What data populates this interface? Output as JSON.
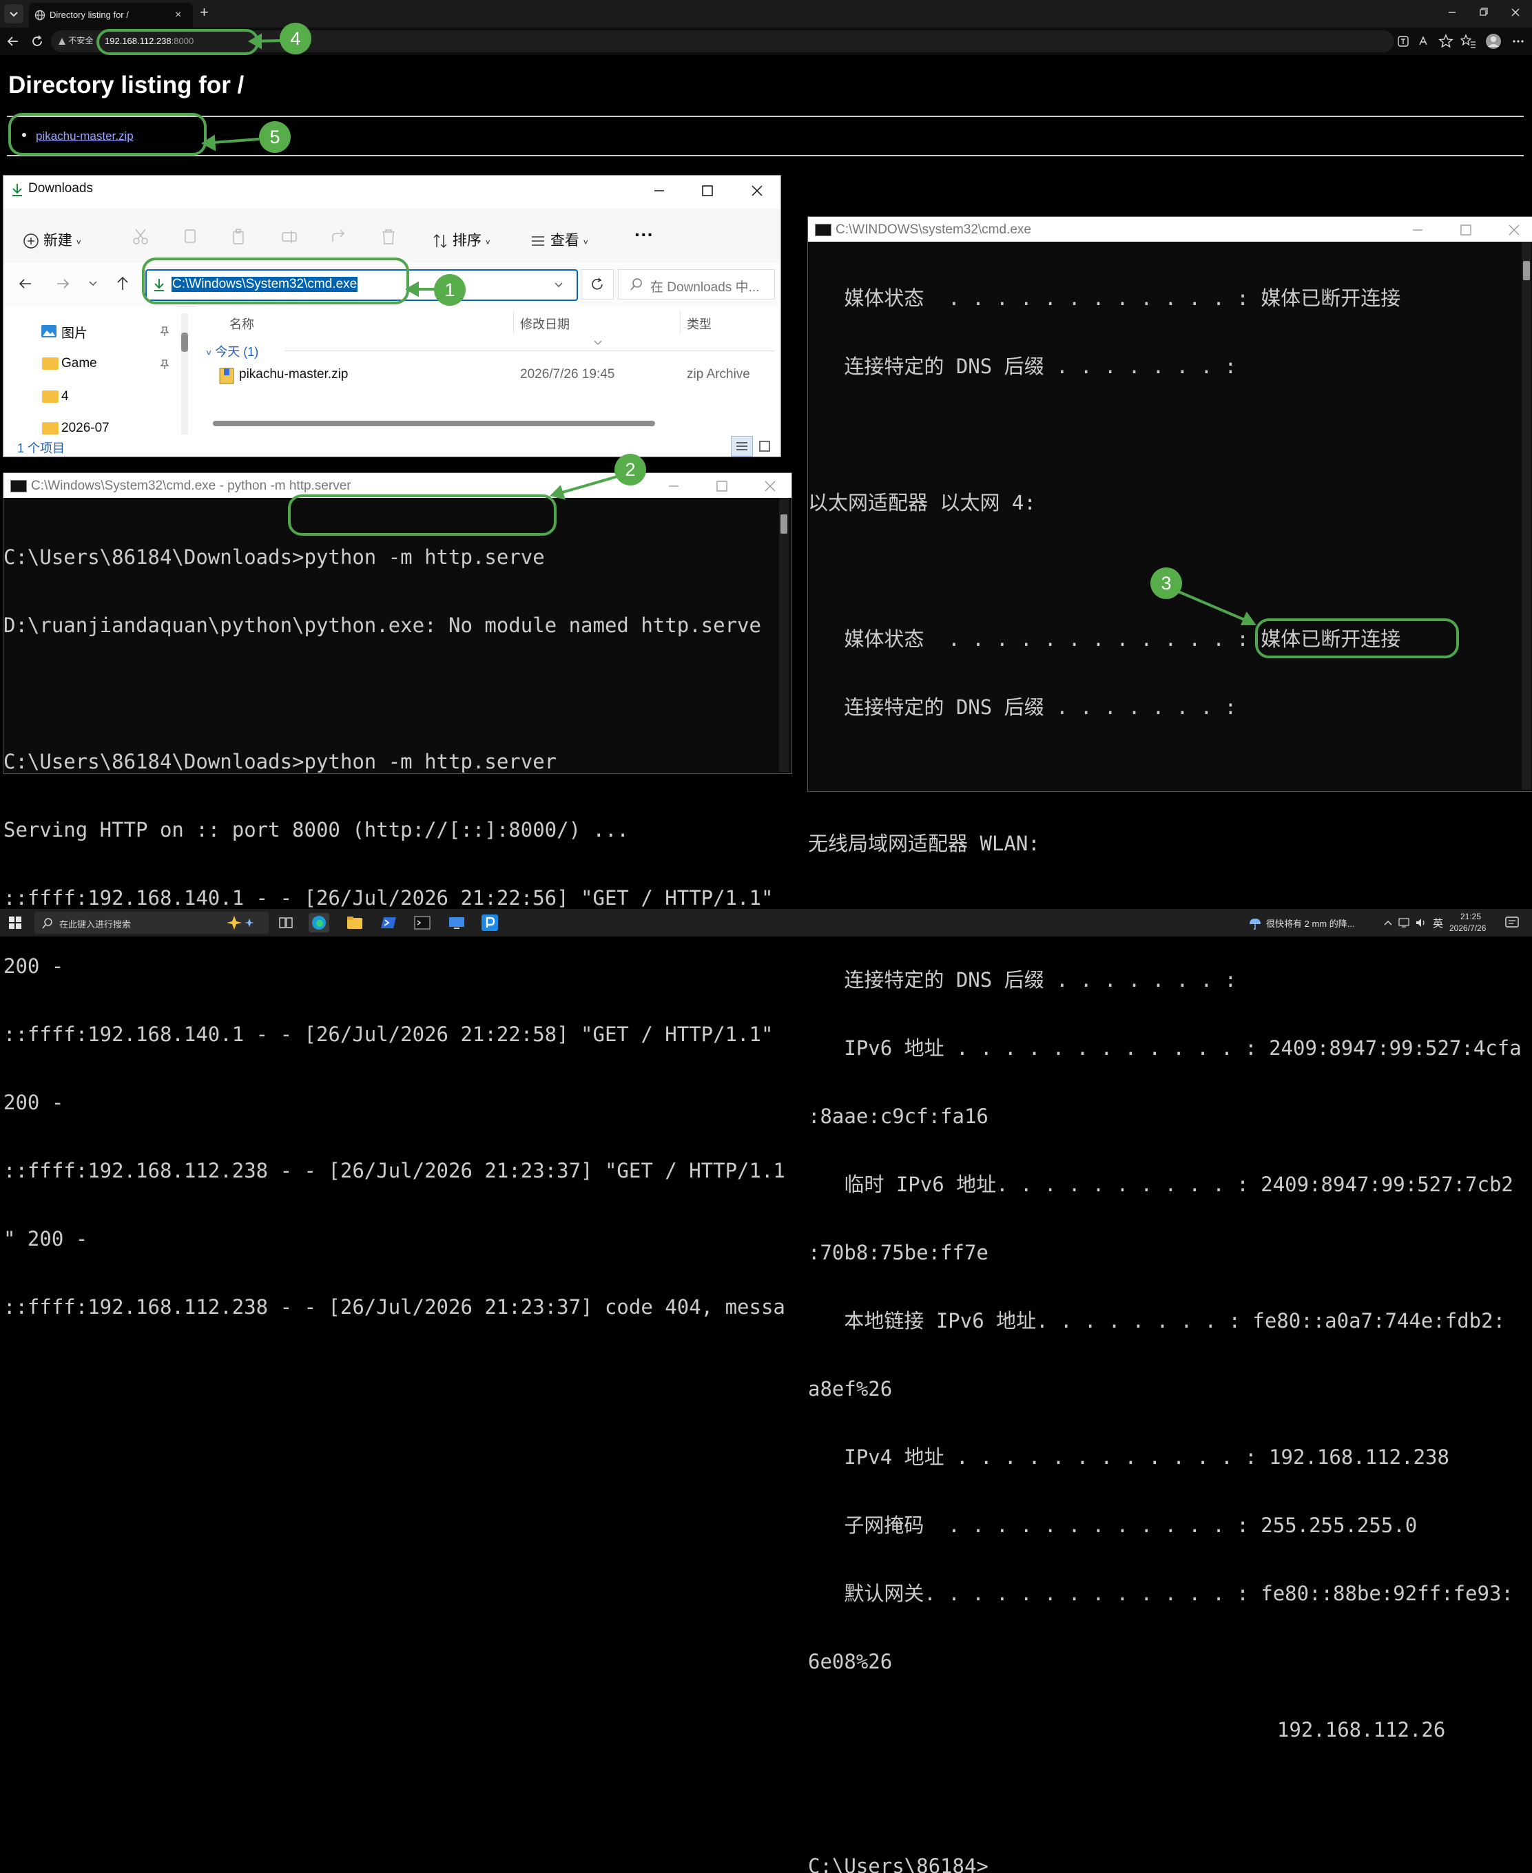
{
  "browser": {
    "tab_title": "Directory listing for /",
    "tab_close": "×",
    "new_tab": "+",
    "address_security": "不安全",
    "address_host": "192.168.112.238",
    "address_port": ":8000",
    "page_title": "Directory listing for /",
    "links": [
      "pikachu-master.zip"
    ]
  },
  "explorer": {
    "title": "Downloads",
    "toolbar": {
      "new_label": "新建",
      "sort_label": "排序",
      "view_label": "查看",
      "more_label": "···"
    },
    "address_value": "C:\\Windows\\System32\\cmd.exe",
    "search_placeholder": "在 Downloads 中...",
    "sidebar": [
      "图片",
      "Game",
      "4",
      "2026-07"
    ],
    "columns": {
      "name": "名称",
      "date": "修改日期",
      "type": "类型"
    },
    "group_label": "今天 (1)",
    "files": [
      {
        "name": "pikachu-master.zip",
        "date": "2026/7/26 19:45",
        "type": "zip Archive"
      }
    ],
    "status": "1 个项目"
  },
  "cmd_server": {
    "title": "C:\\Windows\\System32\\cmd.exe - python  -m http.server",
    "lines": [
      "C:\\Users\\86184\\Downloads>python -m http.serve",
      "D:\\ruanjiandaquan\\python\\python.exe: No module named http.serve",
      "",
      "C:\\Users\\86184\\Downloads>python -m http.server",
      "Serving HTTP on :: port 8000 (http://[::]:8000/) ...",
      "::ffff:192.168.140.1 - - [26/Jul/2026 21:22:56] \"GET / HTTP/1.1\"",
      "200 -",
      "::ffff:192.168.140.1 - - [26/Jul/2026 21:22:58] \"GET / HTTP/1.1\"",
      "200 -",
      "::ffff:192.168.112.238 - - [26/Jul/2026 21:23:37] \"GET / HTTP/1.1",
      "\" 200 -",
      "::ffff:192.168.112.238 - - [26/Jul/2026 21:23:37] code 404, messa"
    ]
  },
  "cmd_ipconfig": {
    "title": "C:\\WINDOWS\\system32\\cmd.exe",
    "lines": [
      "   媒体状态  . . . . . . . . . . . . : 媒体已断开连接",
      "   连接特定的 DNS 后缀 . . . . . . . :",
      "",
      "以太网适配器 以太网 4:",
      "",
      "   媒体状态  . . . . . . . . . . . . : 媒体已断开连接",
      "   连接特定的 DNS 后缀 . . . . . . . :",
      "",
      "无线局域网适配器 WLAN:",
      "",
      "   连接特定的 DNS 后缀 . . . . . . . :",
      "   IPv6 地址 . . . . . . . . . . . . : 2409:8947:99:527:4cfa",
      ":8aae:c9cf:fa16",
      "   临时 IPv6 地址. . . . . . . . . . : 2409:8947:99:527:7cb2",
      ":70b8:75be:ff7e",
      "   本地链接 IPv6 地址. . . . . . . . : fe80::a0a7:744e:fdb2:",
      "a8ef%26",
      "   IPv4 地址 . . . . . . . . . . . . : 192.168.112.238",
      "   子网掩码  . . . . . . . . . . . . : 255.255.255.0",
      "   默认网关. . . . . . . . . . . . . : fe80::88be:92ff:fe93:",
      "6e08%26",
      "                                       192.168.112.26",
      "",
      "C:\\Users\\86184>"
    ]
  },
  "annotations": [
    "1",
    "2",
    "3",
    "4",
    "5"
  ],
  "taskbar": {
    "search_placeholder": "在此键入进行搜索",
    "weather": "很快将有 2 mm 的降...",
    "lang": "英",
    "time": "21:25",
    "date": "2026/7/26"
  },
  "colors": {
    "annotation": "#4fa64c",
    "link": "#9aa6ff",
    "selection": "#0063b1"
  }
}
